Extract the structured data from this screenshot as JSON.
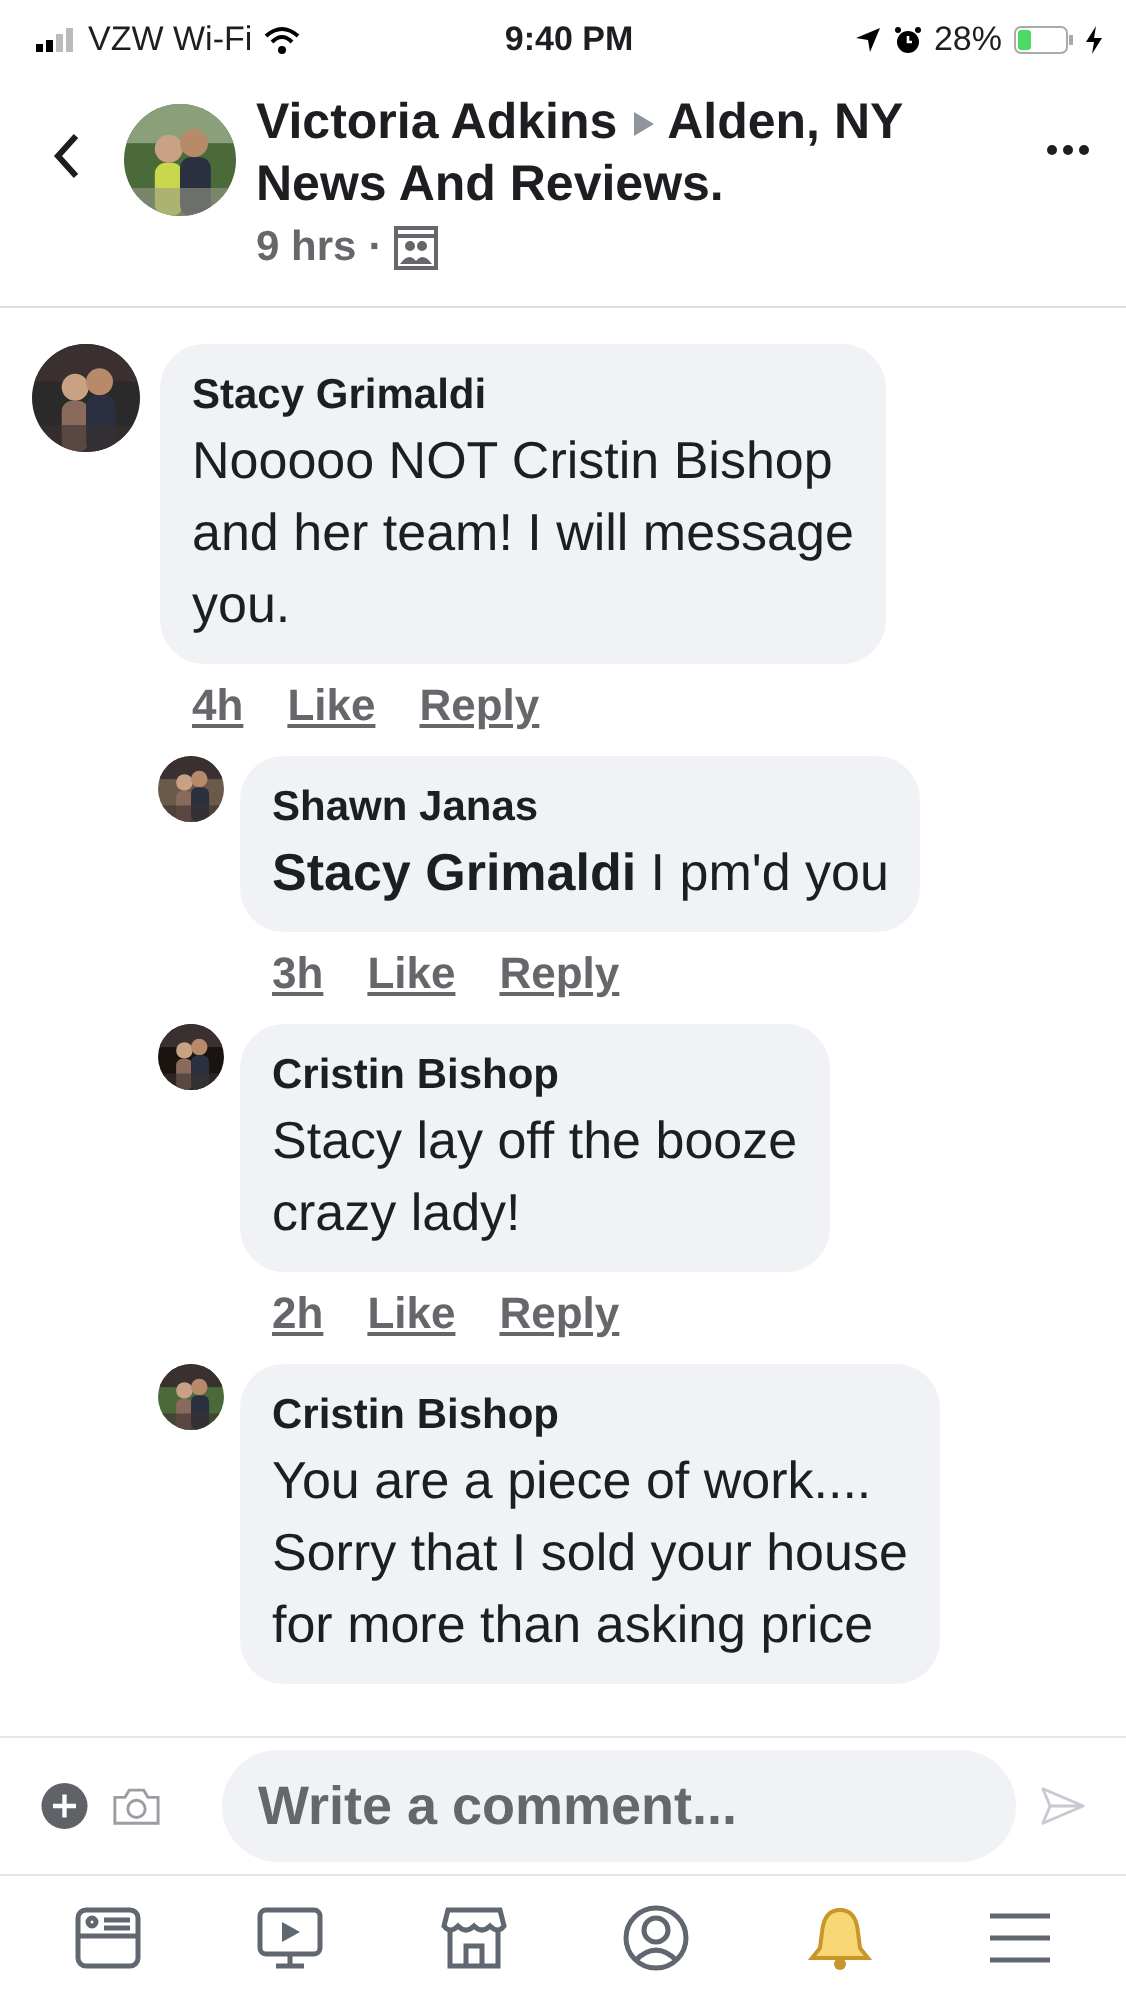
{
  "status_bar": {
    "carrier": "VZW Wi-Fi",
    "time": "9:40 PM",
    "battery": "28%"
  },
  "post": {
    "author": "Victoria Adkins",
    "group": "Alden, NY",
    "group_line2": "News And Reviews.",
    "time": "9 hrs",
    "separator": "·"
  },
  "comments": [
    {
      "kind": "comment",
      "author": "Stacy Grimaldi",
      "lines": [
        "Nooooo NOT Cristin Bishop",
        "and her team! I will message",
        "you."
      ],
      "time": "4h",
      "like": "Like",
      "reply": "Reply"
    },
    {
      "kind": "reply",
      "author": "Shawn Janas",
      "lines": [
        "**Stacy Grimaldi** I pm'd you"
      ],
      "time": "3h",
      "like": "Like",
      "reply": "Reply"
    },
    {
      "kind": "reply",
      "author": "Cristin Bishop",
      "lines": [
        "Stacy lay off the booze",
        "crazy lady!"
      ],
      "time": "2h",
      "like": "Like",
      "reply": "Reply"
    },
    {
      "kind": "reply",
      "author": "Cristin Bishop",
      "lines": [
        "You are a piece of work....",
        "Sorry that I sold your house",
        "for more than asking price"
      ]
    }
  ],
  "composer": {
    "placeholder": "Write a comment..."
  },
  "tabs": [
    {
      "kind": "news",
      "selected": false
    },
    {
      "kind": "video",
      "selected": false
    },
    {
      "kind": "market",
      "selected": false
    },
    {
      "kind": "profile",
      "selected": false
    },
    {
      "kind": "notifications",
      "selected": true
    },
    {
      "kind": "menu",
      "selected": false
    }
  ]
}
